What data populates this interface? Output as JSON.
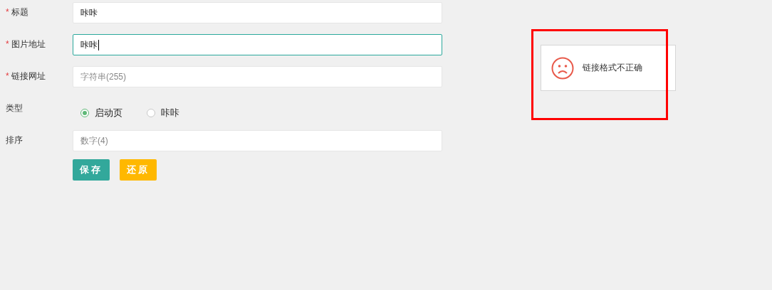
{
  "form": {
    "fields": [
      {
        "kind": "input",
        "label": "标题",
        "required_mark": "*",
        "value": "咔咔",
        "focused": false
      },
      {
        "kind": "input",
        "label": "图片地址",
        "required_mark": "*",
        "value": "咔咔",
        "focused": true
      },
      {
        "kind": "input",
        "label": "链接网址",
        "required_mark": "*",
        "placeholder": "字符串(255)",
        "focused": false
      },
      {
        "kind": "radio",
        "label": "类型",
        "options": [
          {
            "label": "启动页",
            "selected": true
          },
          {
            "label": "咔咔",
            "selected": false
          }
        ]
      },
      {
        "kind": "input",
        "label": "排序",
        "placeholder": "数字(4)",
        "focused": false
      }
    ],
    "buttons": [
      {
        "label": "保存",
        "kind": "primary"
      },
      {
        "label": "还原",
        "kind": "warning"
      }
    ]
  },
  "toast": {
    "message": "链接格式不正确"
  }
}
